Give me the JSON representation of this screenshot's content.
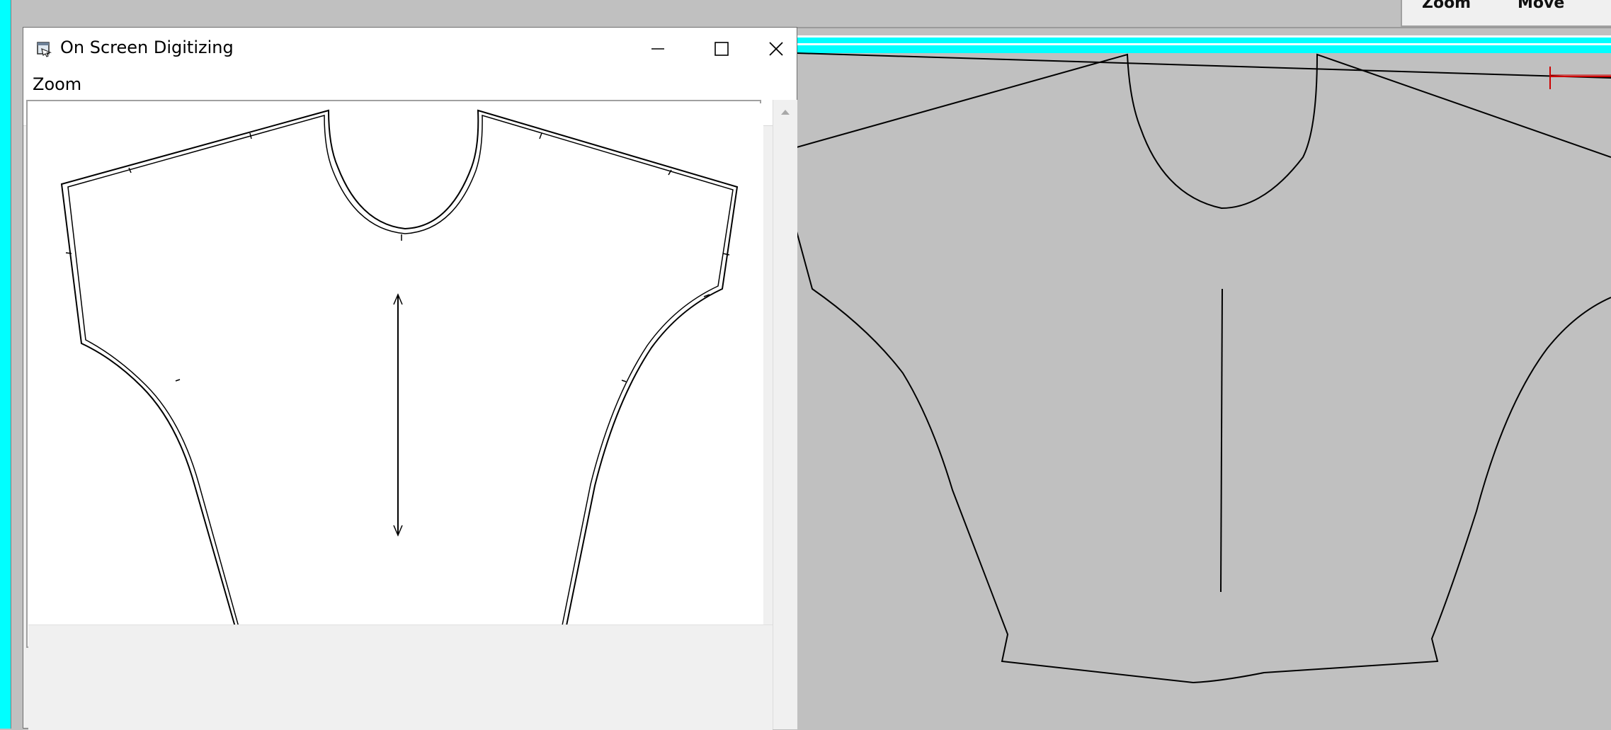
{
  "background_app": {
    "toolbar": {
      "zoom_label": "Zoom",
      "move_label": "Move"
    },
    "colors": {
      "cyan": "#00ffff",
      "canvas": "#c0c0c0",
      "marker": "#cc0000"
    }
  },
  "dialog": {
    "title": "On Screen Digitizing",
    "icon": "digitize-app-icon",
    "window_buttons": [
      "minimize-icon",
      "maximize-icon",
      "close-icon"
    ],
    "menu": {
      "zoom_label": "Zoom"
    }
  }
}
